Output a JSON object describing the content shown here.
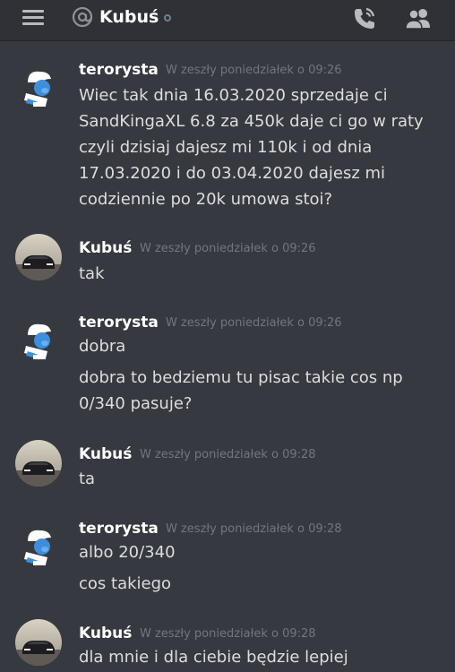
{
  "header": {
    "channel_name": "Kubuś",
    "icons": {
      "menu": "hamburger-menu-icon",
      "channel_type": "at-sign-icon",
      "status": "offline-status-icon",
      "call": "phone-call-icon",
      "members": "members-icon"
    }
  },
  "messages": [
    {
      "author": "terorysta",
      "timestamp": "W zeszły poniedziałek o 09:26",
      "avatar": "smurf-avatar",
      "lines": [
        "Wiec tak dnia 16.03.2020 sprzedaje ci",
        "SandKingaXL 6.8 za 450k daje ci go w raty",
        "czyli dzisiaj dajesz mi 110k i od dnia",
        "17.03.2020 i do 03.04.2020 dajesz mi",
        "codziennie po 20k umowa stoi?"
      ]
    },
    {
      "author": "Kubuś",
      "timestamp": "W zeszły poniedziałek o 09:26",
      "avatar": "car-avatar",
      "lines": [
        "tak"
      ]
    },
    {
      "author": "terorysta",
      "timestamp": "W zeszły poniedziałek o 09:26",
      "avatar": "smurf-avatar",
      "lines": [
        "dobra",
        "dobra to bedziemu tu pisac takie cos np",
        "0/340 pasuje?"
      ]
    },
    {
      "author": "Kubuś",
      "timestamp": "W zeszły poniedziałek o 09:28",
      "avatar": "car-avatar",
      "lines": [
        "ta"
      ]
    },
    {
      "author": "terorysta",
      "timestamp": "W zeszły poniedziałek o 09:28",
      "avatar": "smurf-avatar",
      "lines": [
        "albo 20/340",
        "cos takiego"
      ]
    },
    {
      "author": "Kubuś",
      "timestamp": "W zeszły poniedziałek o 09:28",
      "avatar": "car-avatar",
      "lines": [
        "dla mnie i dla ciebie będzie lepiej"
      ]
    }
  ],
  "colors": {
    "background": "#36393f",
    "header_background": "#2f3136",
    "text": "#dcddde",
    "author": "#ffffff",
    "timestamp": "#72767d"
  }
}
